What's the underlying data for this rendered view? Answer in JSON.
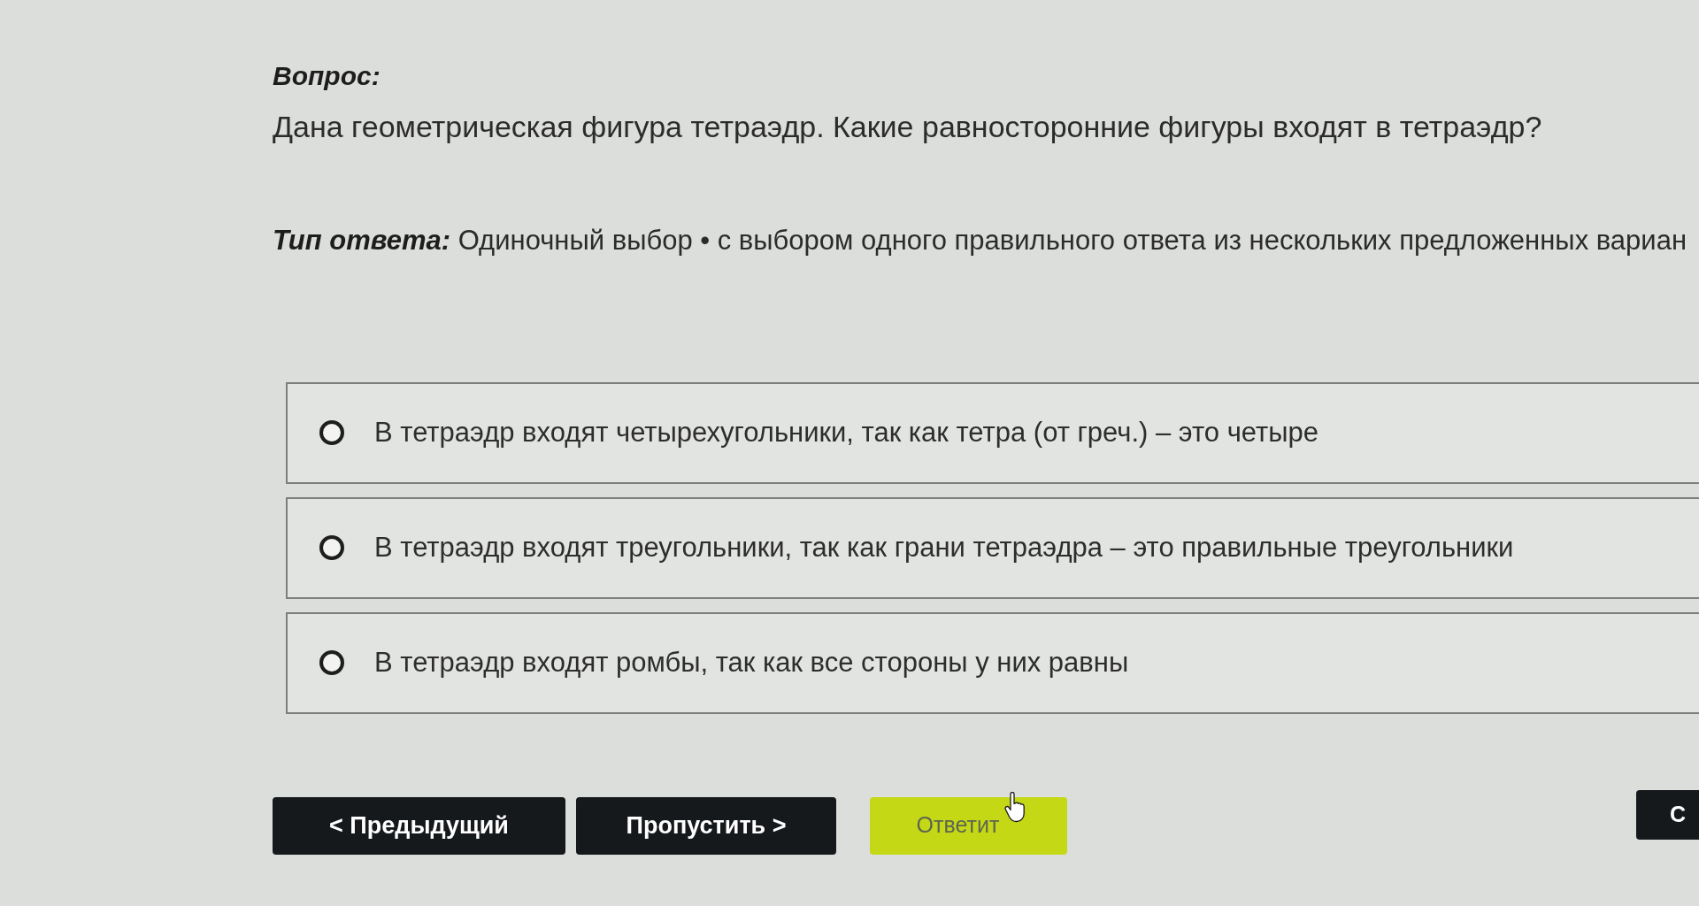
{
  "question": {
    "heading": "Вопрос:",
    "text": "Дана геометрическая фигура тетраэдр. Какие равносторонние фигуры входят в тетраэдр?"
  },
  "answer_type": {
    "label": "Тип ответа:",
    "value": "Одиночный выбор • с выбором одного правильного ответа из нескольких предложенных вариан"
  },
  "options": [
    {
      "text": "В тетраэдр входят четырехугольники, так как тетра (от греч.) – это четыре",
      "selected": false
    },
    {
      "text": "В тетраэдр входят треугольники, так как грани тетраэдра – это правильные треугольники",
      "selected": false
    },
    {
      "text": "В тетраэдр входят ромбы, так как все стороны у них равны",
      "selected": false
    }
  ],
  "buttons": [
    {
      "label": "< Предыдущий",
      "kind": "dark",
      "disabled": false
    },
    {
      "label": "Пропустить >",
      "kind": "dark",
      "disabled": false
    },
    {
      "label": "Ответит",
      "kind": "accent",
      "disabled": true
    }
  ],
  "edge_button": {
    "label": "С"
  }
}
